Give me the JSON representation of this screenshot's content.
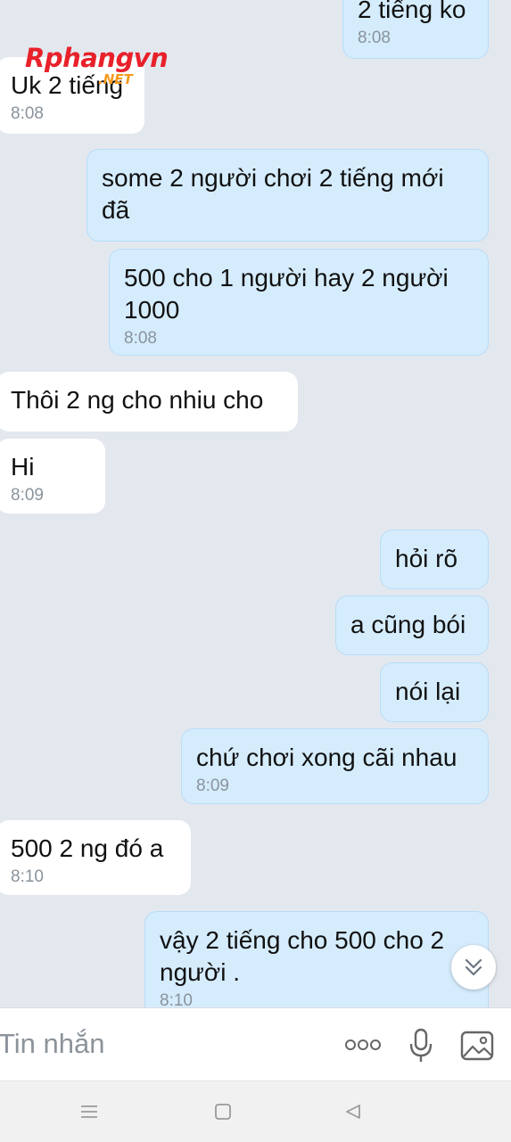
{
  "watermark": {
    "brand": "Rphangvn",
    "suffix": ".NET"
  },
  "messages": [
    {
      "side": "out",
      "text": "2 tiếng ko",
      "time": "8:08"
    },
    {
      "side": "in",
      "text": "Uk 2 tiếng",
      "time": "8:08"
    },
    {
      "side": "out",
      "text": "some 2 người chơi 2 tiếng mới đã",
      "time": ""
    },
    {
      "side": "out",
      "text": "500 cho 1 người hay 2 người 1000",
      "time": "8:08"
    },
    {
      "side": "in",
      "text": "Thôi 2 ng cho nhiu cho",
      "time": ""
    },
    {
      "side": "in",
      "text": "Hi",
      "time": "8:09"
    },
    {
      "side": "out",
      "text": "hỏi rõ",
      "time": ""
    },
    {
      "side": "out",
      "text": "a cũng bói",
      "time": ""
    },
    {
      "side": "out",
      "text": "nói lại",
      "time": ""
    },
    {
      "side": "out",
      "text": "chứ chơi xong cãi nhau",
      "time": "8:09"
    },
    {
      "side": "in",
      "text": "500 2 ng đó a",
      "time": "8:10"
    },
    {
      "side": "out",
      "text": "vậy 2 tiếng cho 500 cho 2 người .",
      "time": "8:10"
    }
  ],
  "composer": {
    "placeholder": "Tin nhắn"
  },
  "icons": {
    "scroll_down": "double-chevron-down-icon",
    "more": "more-dots-icon",
    "mic": "microphone-icon",
    "image": "image-icon",
    "nav_menu": "menu-icon",
    "nav_home": "home-square-icon",
    "nav_back": "back-triangle-icon"
  },
  "colors": {
    "background": "#e3e8ef",
    "incoming": "#ffffff",
    "outgoing": "#d5ecfd",
    "time": "#8a939c"
  }
}
